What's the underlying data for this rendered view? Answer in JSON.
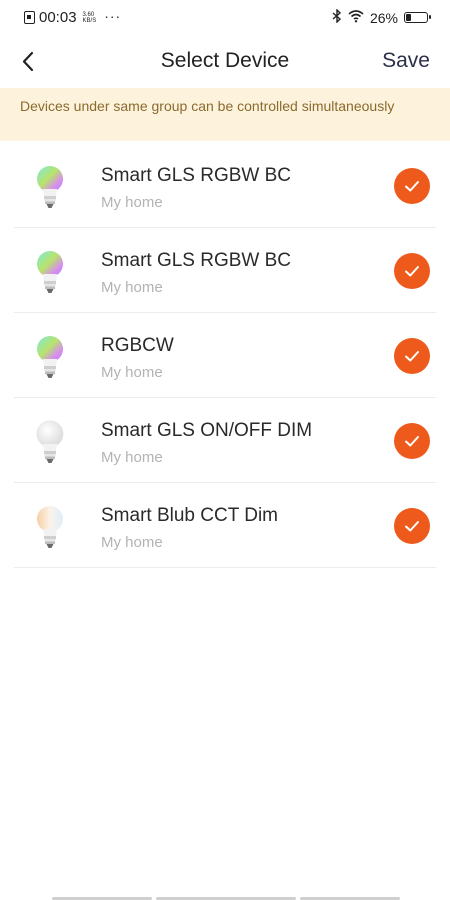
{
  "status_bar": {
    "time": "00:03",
    "net_speed_value": "3.60",
    "net_speed_unit": "KB/S",
    "more": "···",
    "bluetooth_icon": "bluetooth-icon",
    "wifi_icon": "wifi-icon",
    "battery_percent": "26%",
    "battery_level": 0.26
  },
  "nav": {
    "back_icon": "back-chevron-icon",
    "title": "Select Device",
    "save_label": "Save"
  },
  "notice": {
    "text": "Devices under same group can be controlled simultaneously"
  },
  "devices": [
    {
      "name": "Smart GLS RGBW BC",
      "room": "My home",
      "icon": "rgb-bulb-icon",
      "selected": true
    },
    {
      "name": "Smart GLS RGBW BC",
      "room": "My home",
      "icon": "rgb-bulb-icon",
      "selected": true
    },
    {
      "name": "RGBCW",
      "room": "My home",
      "icon": "rgb-bulb-icon",
      "selected": true
    },
    {
      "name": "Smart GLS ON/OFF DIM",
      "room": "My home",
      "icon": "white-bulb-icon",
      "selected": true
    },
    {
      "name": "Smart Blub CCT Dim",
      "room": "My home",
      "icon": "cct-bulb-icon",
      "selected": true
    }
  ],
  "colors": {
    "accent": "#ee5a1c",
    "notice_bg": "#fdf3dc",
    "notice_text": "#8a6a2e"
  }
}
